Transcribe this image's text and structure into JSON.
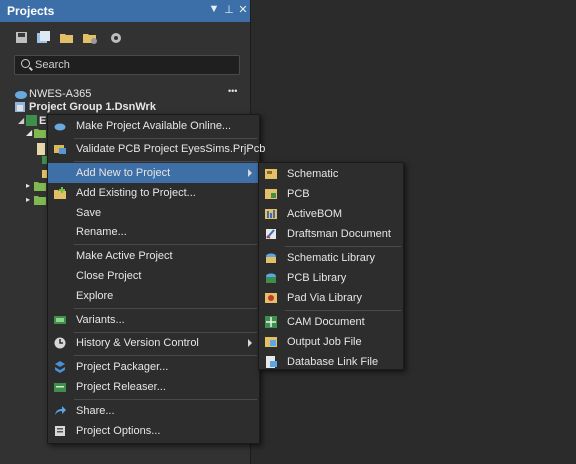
{
  "panel": {
    "title": "Projects",
    "controls": {
      "menu": "▼",
      "pin": "⊥",
      "close": "✕"
    },
    "search_placeholder": "Search",
    "tree": {
      "workspace": "NWES-A365",
      "workspace_more": "•••",
      "group": "Project Group 1.DsnWrk",
      "project_stub": "E"
    }
  },
  "context_menu": {
    "items": [
      {
        "label": "Make Project Available Online...",
        "icon": "cloud-icon"
      },
      {
        "label": "Validate PCB Project EyesSims.PrjPcb",
        "icon": "validate-icon"
      },
      {
        "label": "Add New to Project",
        "icon": "",
        "submenu": true,
        "highlighted": true
      },
      {
        "label": "Add Existing to Project...",
        "icon": "add-existing-icon"
      },
      {
        "label": "Save",
        "icon": ""
      },
      {
        "label": "Rename...",
        "icon": ""
      },
      {
        "label": "Make Active Project",
        "icon": ""
      },
      {
        "label": "Close Project",
        "icon": ""
      },
      {
        "label": "Explore",
        "icon": ""
      },
      {
        "label": "Variants...",
        "icon": "variants-icon"
      },
      {
        "label": "History & Version Control",
        "icon": "history-icon",
        "submenu": true
      },
      {
        "label": "Project Packager...",
        "icon": "packager-icon"
      },
      {
        "label": "Project Releaser...",
        "icon": "releaser-icon"
      },
      {
        "label": "Share...",
        "icon": "share-icon"
      },
      {
        "label": "Project Options...",
        "icon": "options-icon"
      }
    ]
  },
  "submenu": {
    "items": [
      {
        "label": "Schematic",
        "icon": "schematic-icon"
      },
      {
        "label": "PCB",
        "icon": "pcb-icon"
      },
      {
        "label": "ActiveBOM",
        "icon": "activebom-icon"
      },
      {
        "label": "Draftsman Document",
        "icon": "draftsman-icon"
      },
      {
        "label": "Schematic Library",
        "icon": "schlib-icon"
      },
      {
        "label": "PCB Library",
        "icon": "pcblib-icon"
      },
      {
        "label": "Pad Via Library",
        "icon": "padvia-icon"
      },
      {
        "label": "CAM Document",
        "icon": "cam-icon"
      },
      {
        "label": "Output Job File",
        "icon": "outjob-icon"
      },
      {
        "label": "Database Link File",
        "icon": "dblink-icon"
      }
    ]
  },
  "colors": {
    "accent": "#3e6fa7",
    "titlebar": "#3c6fa8",
    "menu_bg": "#2d2d2d",
    "panel_bg": "#323232"
  }
}
